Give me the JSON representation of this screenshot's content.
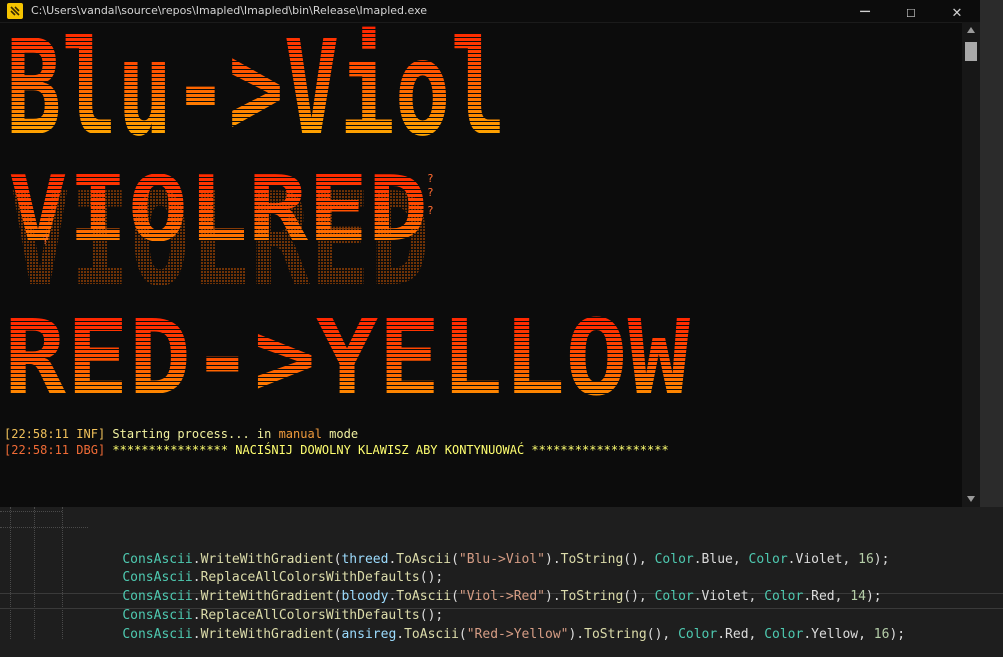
{
  "window": {
    "title": "C:\\Users\\vandal\\source\\repos\\Imapled\\Imapled\\bin\\Release\\Imapled.exe",
    "minimize_symbol": "─",
    "maximize_symbol": "☐",
    "close_symbol": "✕",
    "icons": {
      "app": "app-icon",
      "scroll_up": "triangle-up-icon",
      "scroll_down": "triangle-down-icon"
    }
  },
  "banners": [
    {
      "text": "Blu->Viol"
    },
    {
      "text": "VIOLRED"
    },
    {
      "text": "RED->YELLOW"
    }
  ],
  "console_log": [
    {
      "time": "[22:58:11",
      "level": "INF]",
      "message_1": "Starting process... in ",
      "keyword": "manual",
      "message_2": " mode"
    },
    {
      "time": "[22:58:11",
      "level": "DBG]",
      "message_1": "**************** NACIŚNIJ DOWOLNY KLAWISZ ABY KONTYNUOWAĆ *******************"
    }
  ],
  "code_lines": [
    [
      "ConsAscii",
      ".",
      "WriteWithGradient",
      "(",
      "threed",
      ".",
      "ToAscii",
      "(",
      "\"Blu->Viol\"",
      ").",
      "ToString",
      "(), ",
      "Color",
      ".Blue, ",
      "Color",
      ".Violet, ",
      "16",
      ");"
    ],
    [
      "ConsAscii",
      ".",
      "ReplaceAllColorsWithDefaults",
      "();"
    ],
    [
      "ConsAscii",
      ".",
      "WriteWithGradient",
      "(",
      "bloody",
      ".",
      "ToAscii",
      "(",
      "\"Viol->Red\"",
      ").",
      "ToString",
      "(), ",
      "Color",
      ".Violet, ",
      "Color",
      ".Red, ",
      "14",
      ");"
    ],
    [
      "ConsAscii",
      ".",
      "ReplaceAllColorsWithDefaults",
      "();"
    ],
    [
      "ConsAscii",
      ".",
      "WriteWithGradient",
      "(",
      "ansireg",
      ".",
      "ToAscii",
      "(",
      "\"Red->Yellow\"",
      ").",
      "ToString",
      "(), ",
      "Color",
      ".Red, ",
      "Color",
      ".Yellow, ",
      "16",
      ");"
    ]
  ],
  "colors": {
    "gradient_red": "#ff1a00",
    "gradient_orange": "#ff7a00",
    "gradient_yellow": "#ffcc00",
    "console_bg": "#0c0c0c",
    "editor_bg": "#1e1e1e"
  }
}
